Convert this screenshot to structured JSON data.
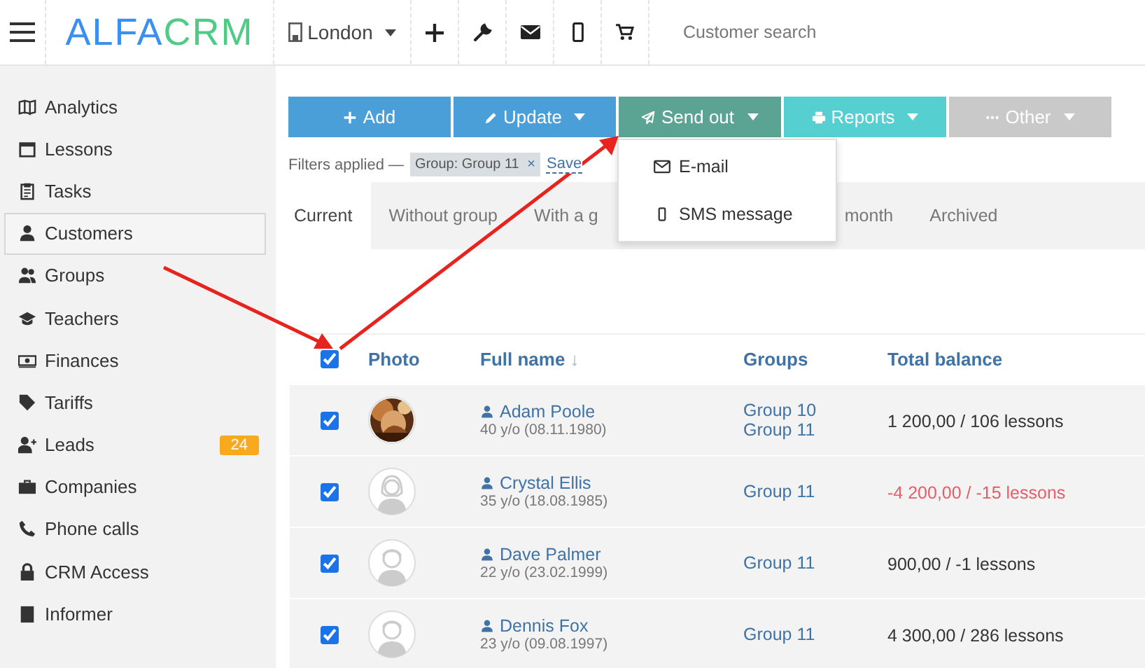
{
  "topbar": {
    "logo_start": "ALFA",
    "logo_end": "CRM",
    "branch": "London",
    "search": {
      "placeholder": "Customer search"
    }
  },
  "sidebar": {
    "items": [
      {
        "label": "Analytics",
        "selected": false
      },
      {
        "label": "Lessons",
        "selected": false
      },
      {
        "label": "Tasks",
        "selected": false
      },
      {
        "label": "Customers",
        "selected": true
      },
      {
        "label": "Groups",
        "selected": false
      },
      {
        "label": "Teachers",
        "selected": false
      },
      {
        "label": "Finances",
        "selected": false
      },
      {
        "label": "Tariffs",
        "selected": false
      },
      {
        "label": "Leads",
        "selected": false,
        "badge": "24"
      },
      {
        "label": "Companies",
        "selected": false
      },
      {
        "label": "Phone calls",
        "selected": false
      },
      {
        "label": "CRM Access",
        "selected": false
      },
      {
        "label": "Informer",
        "selected": false
      }
    ]
  },
  "toolbar": [
    {
      "label": "Add",
      "dropdown": false
    },
    {
      "label": "Update",
      "dropdown": true
    },
    {
      "label": "Send out",
      "dropdown": true
    },
    {
      "label": "Reports",
      "dropdown": true
    },
    {
      "label": "Other",
      "dropdown": true
    }
  ],
  "filters": {
    "label": "Filters applied —",
    "chip": "Group: Group 11",
    "chip_close": "×",
    "save": "Save"
  },
  "send_menu": [
    {
      "label": "E-mail"
    },
    {
      "label": "SMS message"
    }
  ],
  "tabs": [
    {
      "label": "Current",
      "selected": true
    },
    {
      "label": "Without group",
      "selected": false
    },
    {
      "label": "With a g",
      "label_tail": "month",
      "selected": false
    },
    {
      "label": "Archived",
      "selected": false
    }
  ],
  "table": {
    "all_checked": true,
    "columns": [
      "Photo",
      "Full name",
      "Groups",
      "Total balance"
    ],
    "sort_mark": "↓",
    "rows": [
      {
        "checked": true,
        "kind": "picture",
        "name": "Adam Poole",
        "age": "40 y/o (08.11.1980)",
        "groups": [
          "Group 10",
          "Group 11"
        ],
        "balance": "1 200,00 / 106 lessons",
        "negative": false
      },
      {
        "checked": true,
        "kind": "female",
        "name": "Crystal Ellis",
        "age": "35 y/o (18.08.1985)",
        "groups": [
          "Group 11"
        ],
        "balance": "-4 200,00 / -15 lessons",
        "negative": true
      },
      {
        "checked": true,
        "kind": "male",
        "name": "Dave Palmer",
        "age": "22 y/o (23.02.1999)",
        "groups": [
          "Group 11"
        ],
        "balance": "900,00 / -1 lessons",
        "negative": false
      },
      {
        "checked": true,
        "kind": "male",
        "name": "Dennis Fox",
        "age": "23 y/o (09.08.1997)",
        "groups": [
          "Group 11"
        ],
        "balance": "4 300,00 / 286 lessons",
        "negative": false
      }
    ]
  }
}
